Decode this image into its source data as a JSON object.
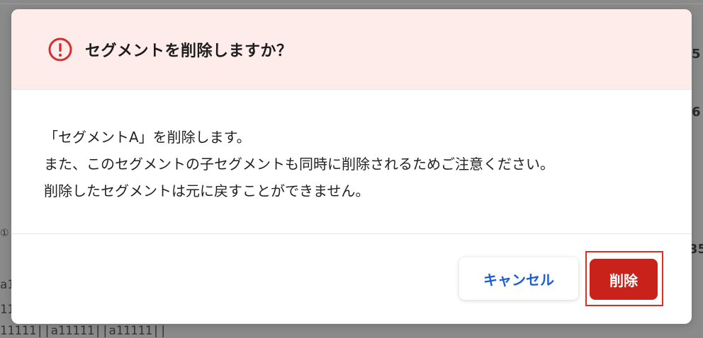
{
  "dialog": {
    "title": "セグメントを削除しますか？",
    "body_lines": [
      "「セグメントA」を削除します。",
      "また、このセグメントの子セグメントも同時に削除されるためご注意ください。",
      "削除したセグメントは元に戻すことができません。"
    ],
    "cancel_label": "キャンセル",
    "delete_label": "削除",
    "accent_color": "#c9221a",
    "header_bg": "#fdecea",
    "warning_icon": "exclamation-circle-icon"
  },
  "background": {
    "fragments": [
      "5",
      "6",
      "35",
      "a1",
      "11",
      "11111||a11111||a11111||",
      "①"
    ]
  }
}
